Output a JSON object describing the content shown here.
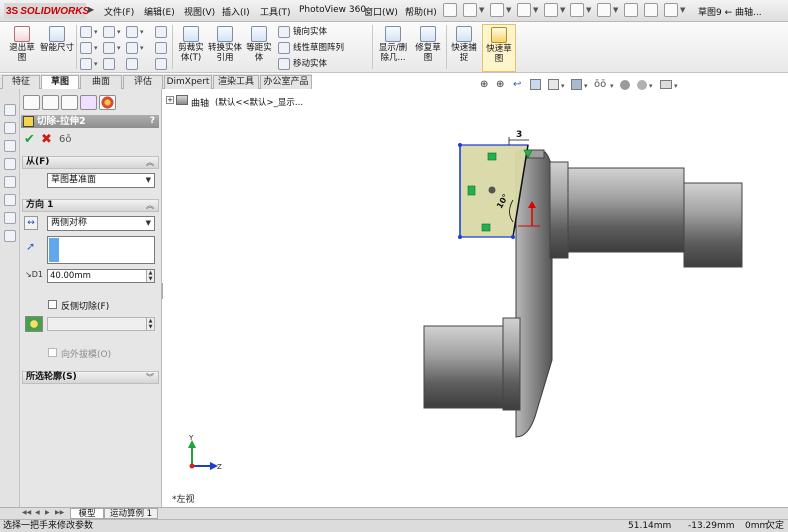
{
  "app": {
    "logo_prefix": "3S",
    "logo_name": "SOLIDWORKS",
    "document_title": "草图9 ← 曲轴..."
  },
  "menu": [
    "文件(F)",
    "编辑(E)",
    "视图(V)",
    "插入(I)",
    "工具(T)",
    "PhotoView 360",
    "窗口(W)",
    "帮助(H)"
  ],
  "commands": {
    "exit_sketch": "退出草图",
    "smart_dimension": "智能尺寸",
    "trim_entities": "剪裁实体(T)",
    "convert_entities": "转换实体引用",
    "offset_entities": "等距实体",
    "mirror_entities": "镜向实体",
    "linear_pattern": "线性草图阵列",
    "move_entities": "移动实体",
    "display_delete_relations": "显示/删除几...",
    "repair_sketch": "修复草图",
    "quick_snaps": "快速捕捉",
    "rapid_sketch": "快速草图"
  },
  "tabs": [
    "特征",
    "草图",
    "曲面",
    "评估",
    "DimXpert",
    "渲染工具",
    "办公室产品"
  ],
  "active_tab": "草图",
  "property_manager": {
    "title": "切除-拉伸2",
    "help": "?",
    "from_group": "从(F)",
    "from_value": "草图基准面",
    "direction_group": "方向 1",
    "end_condition": "两侧对称",
    "depth": "40.00mm",
    "flip_side_label": "反侧切除(F)",
    "draft_outward_label": "向外拔模(O)",
    "selected_contours_group": "所选轮廓(S)"
  },
  "feature_tree": {
    "part_name": "曲轴",
    "config": "(默认<<默认>_显示..."
  },
  "viewport": {
    "dimension_value": "3",
    "angle_value": "10°",
    "view_name": "*左视",
    "axis_y": "Y",
    "axis_z": "Z"
  },
  "bottom_tabs": [
    "模型",
    "运动算例 1"
  ],
  "status": {
    "message": "选择一把手来修改参数",
    "x": "51.14mm",
    "y": "-13.29mm",
    "z": "0mm",
    "state": "欠定义"
  },
  "colors": {
    "sketch_fill": "#d8d8a6",
    "sketch_line": "#1d3fd6",
    "relation_green": "#22b14c",
    "title_red": "#cc0000"
  }
}
